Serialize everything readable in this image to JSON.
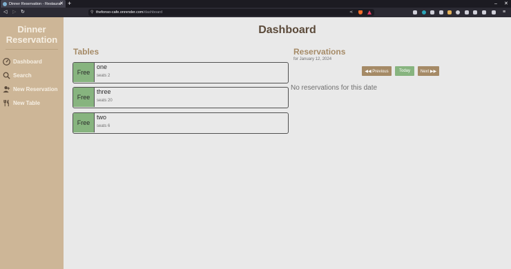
{
  "browser": {
    "tab_title": "Dinner Reservation - Restaurant",
    "tab_close": "✕",
    "new_tab": "+",
    "url_host": "thefonso-cafe.onrender.com",
    "url_path": "/dashboard",
    "window_controls": [
      "–",
      "✕"
    ]
  },
  "sidebar": {
    "brand_line1": "Dinner",
    "brand_line2": "Reservation",
    "items": [
      {
        "label": "Dashboard",
        "icon": "dashboard-icon"
      },
      {
        "label": "Search",
        "icon": "search-icon"
      },
      {
        "label": "New Reservation",
        "icon": "add-user-icon"
      },
      {
        "label": "New Table",
        "icon": "utensils-icon"
      }
    ]
  },
  "main": {
    "title": "Dashboard",
    "tables_title": "Tables",
    "tables": [
      {
        "status": "Free",
        "name": "one",
        "seats": "seats 2"
      },
      {
        "status": "Free",
        "name": "three",
        "seats": "seats 20"
      },
      {
        "status": "Free",
        "name": "two",
        "seats": "seats 6"
      }
    ],
    "reservations_title": "Reservations",
    "reservations_date": "for January 12, 2024",
    "buttons": {
      "previous": "◀◀ Previous",
      "today": "Today",
      "next": "Next ▶▶"
    },
    "empty_message": "No reservations for this date"
  },
  "colors": {
    "sidebar": "#cdb697",
    "accent_brown": "#a58a66",
    "free_green": "#87b47f",
    "title": "#5b4a3a"
  }
}
